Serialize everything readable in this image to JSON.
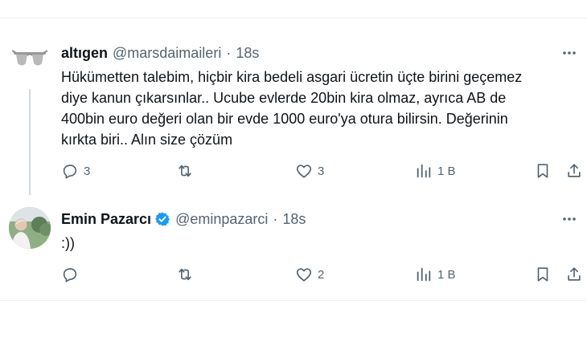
{
  "tweets": [
    {
      "name": "altıgen",
      "handle": "@marsdaimaileri",
      "separator": "·",
      "time": "18s",
      "verified": false,
      "avatar_icon": "sunglasses-avatar",
      "text": "Hükümetten talebim, hiçbir kira bedeli asgari ücretin üçte birini geçemez\ndiye kanun çıkarsınlar.. Ucube evlerde 20bin kira olmaz, ayrıca AB de\n400bin euro değeri olan bir evde 1000 euro'ya otura bilirsin. Değerinin\nkırkta biri.. Alın size çözüm",
      "replies": "3",
      "reposts": "",
      "likes": "3",
      "views": "1 B"
    },
    {
      "name": "Emin Pazarcı",
      "handle": "@eminpazarci",
      "separator": "·",
      "time": "18s",
      "verified": true,
      "avatar_icon": "person-photo-avatar",
      "text": ":))",
      "replies": "",
      "reposts": "",
      "likes": "2",
      "views": "1 B"
    }
  ],
  "colors": {
    "text_primary": "#0f1419",
    "text_secondary": "#536471",
    "verified_blue": "#1d9bf0",
    "divider": "#eff3f4",
    "thread_line": "#cfd9de"
  },
  "icons": {
    "more": "more-horizontal-icon",
    "reply": "reply-icon",
    "repost": "repost-icon",
    "like": "like-icon",
    "views": "views-icon",
    "bookmark": "bookmark-icon",
    "share": "share-icon",
    "verified": "verified-badge-icon"
  }
}
